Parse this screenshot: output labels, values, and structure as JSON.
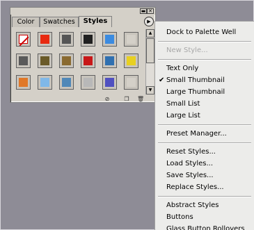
{
  "palette": {
    "tabs": [
      "Color",
      "Swatches",
      "Styles"
    ],
    "active_tab": "Styles",
    "titlebar_buttons": [
      "minimize-icon",
      "close-icon"
    ],
    "menu_button_icon": "right-arrow-circle-icon",
    "styles": [
      {
        "name": "default-none",
        "color": "#ffffff"
      },
      {
        "name": "fire-glow",
        "color": "#e82a10"
      },
      {
        "name": "dark-gray",
        "color": "#555555"
      },
      {
        "name": "black-gloss",
        "color": "#202020"
      },
      {
        "name": "blue-wave",
        "color": "#3b8be0"
      },
      {
        "name": "blank",
        "color": "#d4d0c8"
      },
      {
        "name": "slate-bevel",
        "color": "#5a5a5a"
      },
      {
        "name": "olive",
        "color": "#6a5a28"
      },
      {
        "name": "bronze",
        "color": "#8a6a30"
      },
      {
        "name": "red-glass",
        "color": "#c81818"
      },
      {
        "name": "mosaic",
        "color": "#3070b0"
      },
      {
        "name": "yellow",
        "color": "#e8d020"
      },
      {
        "name": "orange-sunset",
        "color": "#e07828"
      },
      {
        "name": "sky-blue",
        "color": "#80b8e8"
      },
      {
        "name": "landscape",
        "color": "#5088b8"
      },
      {
        "name": "silver-pattern",
        "color": "#b8b8b8"
      },
      {
        "name": "violet-blue",
        "color": "#5050c0"
      },
      {
        "name": "blank",
        "color": "#d4d0c8"
      }
    ],
    "bottom_icons": [
      "clear-style-icon",
      "new-style-icon",
      "delete-icon"
    ]
  },
  "menu": {
    "groups": [
      [
        {
          "label": "Dock to Palette Well",
          "enabled": true,
          "checked": false
        }
      ],
      [
        {
          "label": "New Style...",
          "enabled": false,
          "checked": false
        }
      ],
      [
        {
          "label": "Text Only",
          "enabled": true,
          "checked": false
        },
        {
          "label": "Small Thumbnail",
          "enabled": true,
          "checked": true
        },
        {
          "label": "Large Thumbnail",
          "enabled": true,
          "checked": false
        },
        {
          "label": "Small List",
          "enabled": true,
          "checked": false
        },
        {
          "label": "Large List",
          "enabled": true,
          "checked": false
        }
      ],
      [
        {
          "label": "Preset Manager...",
          "enabled": true,
          "checked": false
        }
      ],
      [
        {
          "label": "Reset Styles...",
          "enabled": true,
          "checked": false
        },
        {
          "label": "Load Styles...",
          "enabled": true,
          "checked": false
        },
        {
          "label": "Save Styles...",
          "enabled": true,
          "checked": false
        },
        {
          "label": "Replace Styles...",
          "enabled": true,
          "checked": false
        }
      ],
      [
        {
          "label": "Abstract Styles",
          "enabled": true,
          "checked": false
        },
        {
          "label": "Buttons",
          "enabled": true,
          "checked": false
        },
        {
          "label": "Glass Button Rollovers",
          "enabled": true,
          "checked": false
        }
      ]
    ],
    "check_glyph": "✔"
  }
}
